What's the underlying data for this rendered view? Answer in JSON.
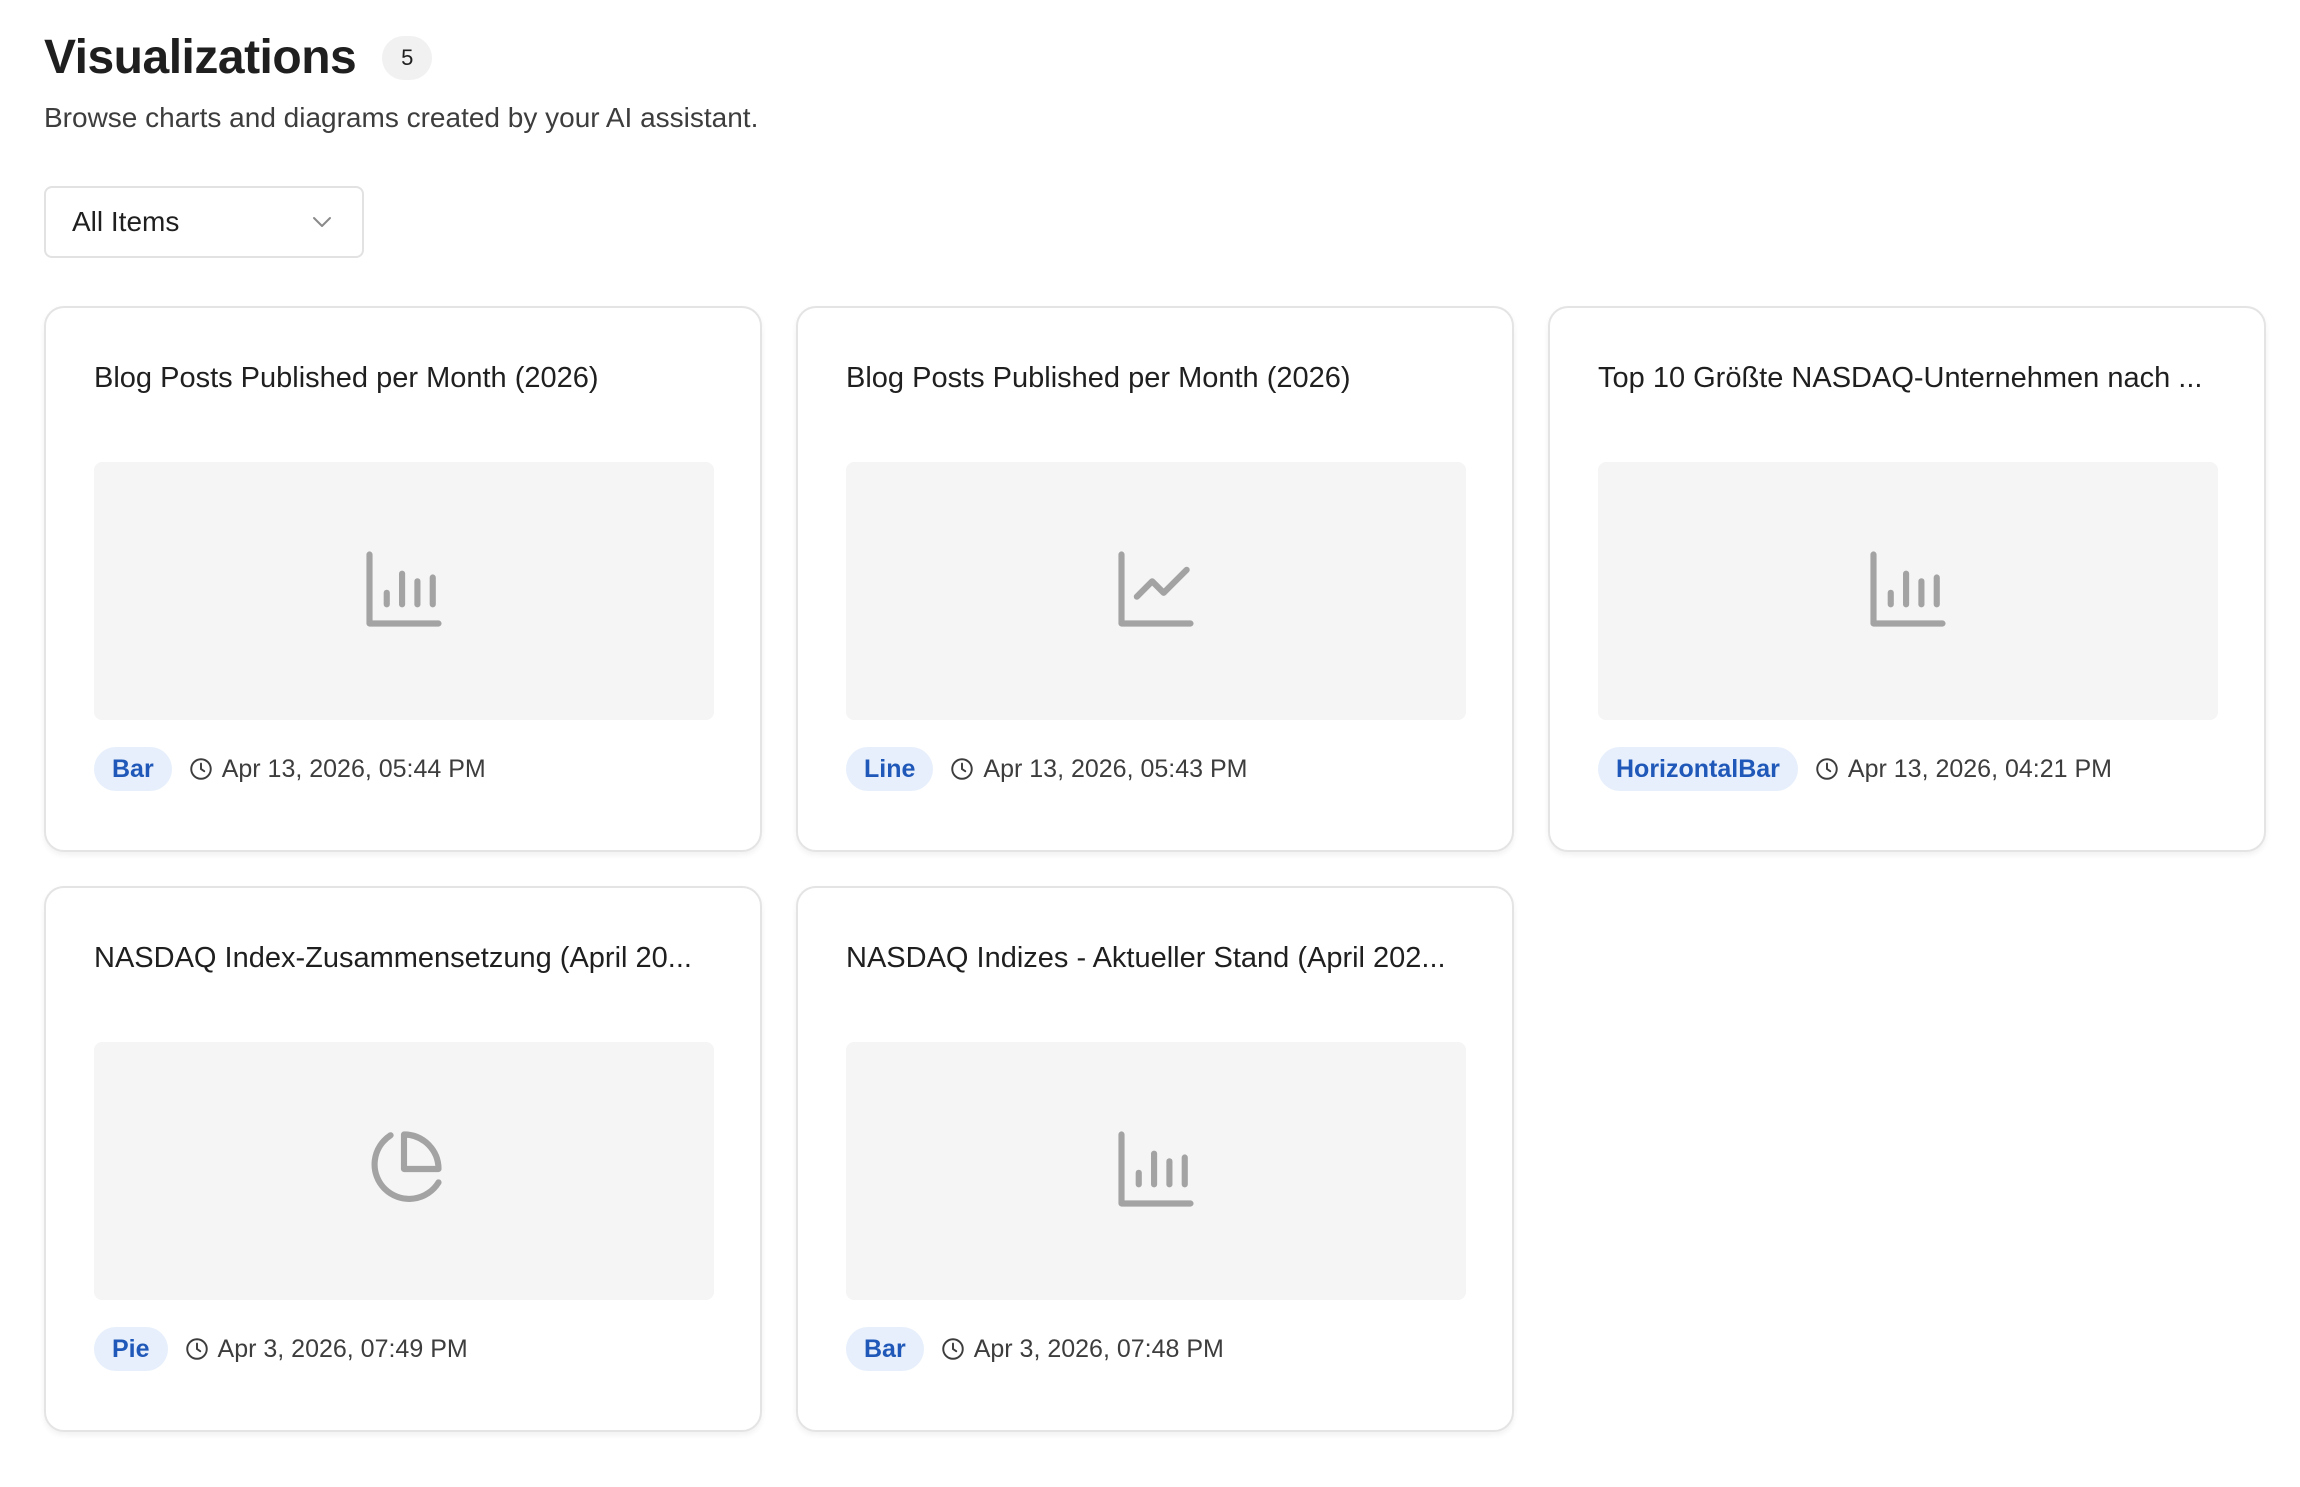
{
  "header": {
    "title": "Visualizations",
    "count": "5",
    "subtitle": "Browse charts and diagrams created by your AI assistant."
  },
  "filter": {
    "selected": "All Items"
  },
  "colors": {
    "badge_bg": "#e6effb",
    "badge_text": "#1f58b8",
    "thumb_bg": "#f5f5f5",
    "icon": "#a3a3a3"
  },
  "cards": [
    {
      "title": "Blog Posts Published per Month (2026)",
      "icon": "bar-chart-icon",
      "type": "Bar",
      "timestamp": "Apr 13, 2026, 05:44 PM"
    },
    {
      "title": "Blog Posts Published per Month (2026)",
      "icon": "line-chart-icon",
      "type": "Line",
      "timestamp": "Apr 13, 2026, 05:43 PM"
    },
    {
      "title": "Top 10 Größte NASDAQ-Unternehmen nach ...",
      "icon": "bar-chart-icon",
      "type": "HorizontalBar",
      "timestamp": "Apr 13, 2026, 04:21 PM"
    },
    {
      "title": "NASDAQ Index-Zusammensetzung (April 20...",
      "icon": "pie-chart-icon",
      "type": "Pie",
      "timestamp": "Apr 3, 2026, 07:49 PM"
    },
    {
      "title": "NASDAQ Indizes - Aktueller Stand (April 202...",
      "icon": "bar-chart-icon",
      "type": "Bar",
      "timestamp": "Apr 3, 2026, 07:48 PM"
    }
  ]
}
